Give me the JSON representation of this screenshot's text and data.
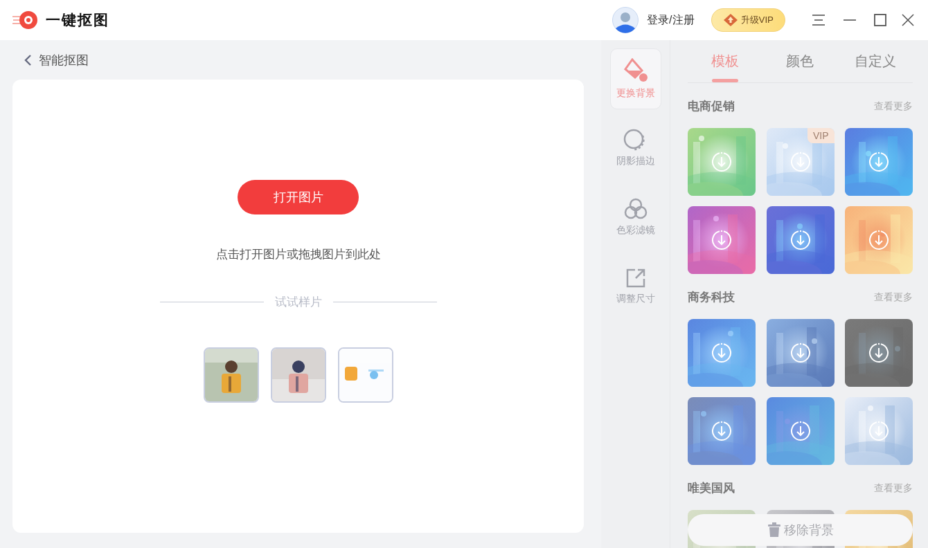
{
  "app": {
    "name": "一键抠图"
  },
  "user": {
    "login": "登录/注册"
  },
  "upgrade": {
    "label": "升级VIP"
  },
  "page": {
    "title": "智能抠图"
  },
  "workspace": {
    "open_button": "打开图片",
    "hint": "点击打开图片或拖拽图片到此处",
    "samples_label": "试试样片",
    "samples": [
      {
        "kind": "picture"
      },
      {
        "kind": "picture"
      },
      {
        "kind": "picture"
      }
    ]
  },
  "tools": [
    {
      "kind": "background",
      "label": "更换背景",
      "selected": true
    },
    {
      "kind": "shadow",
      "label": "阴影描边",
      "selected": false
    },
    {
      "kind": "filter",
      "label": "色彩滤镜",
      "selected": false
    },
    {
      "kind": "resize",
      "label": "调整尺寸",
      "selected": false
    }
  ],
  "tabs": [
    {
      "label": "模板",
      "selected": true
    },
    {
      "label": "颜色",
      "selected": false
    },
    {
      "label": "自定义",
      "selected": false
    }
  ],
  "sections": [
    {
      "title": "电商促销",
      "more": "查看更多",
      "items": [
        {
          "kind": "picture",
          "download": true
        },
        {
          "kind": "picture",
          "download": true,
          "badge": "VIP"
        },
        {
          "kind": "picture",
          "download": true
        },
        {
          "kind": "picture",
          "download": true
        },
        {
          "kind": "picture",
          "download": true
        },
        {
          "kind": "picture",
          "download": true
        }
      ]
    },
    {
      "title": "商务科技",
      "more": "查看更多",
      "items": [
        {
          "kind": "picture",
          "download": true
        },
        {
          "kind": "picture",
          "download": true
        },
        {
          "kind": "picture",
          "download": true
        },
        {
          "kind": "picture",
          "download": true
        },
        {
          "kind": "picture",
          "download": true
        },
        {
          "kind": "picture",
          "download": true
        }
      ]
    },
    {
      "title": "唯美国风",
      "more": "查看更多",
      "items": [
        {
          "kind": "picture",
          "download": false
        },
        {
          "kind": "picture",
          "download": false
        },
        {
          "kind": "picture",
          "download": false
        }
      ]
    }
  ],
  "remove_button": {
    "label": "移除背景",
    "disabled": true
  }
}
